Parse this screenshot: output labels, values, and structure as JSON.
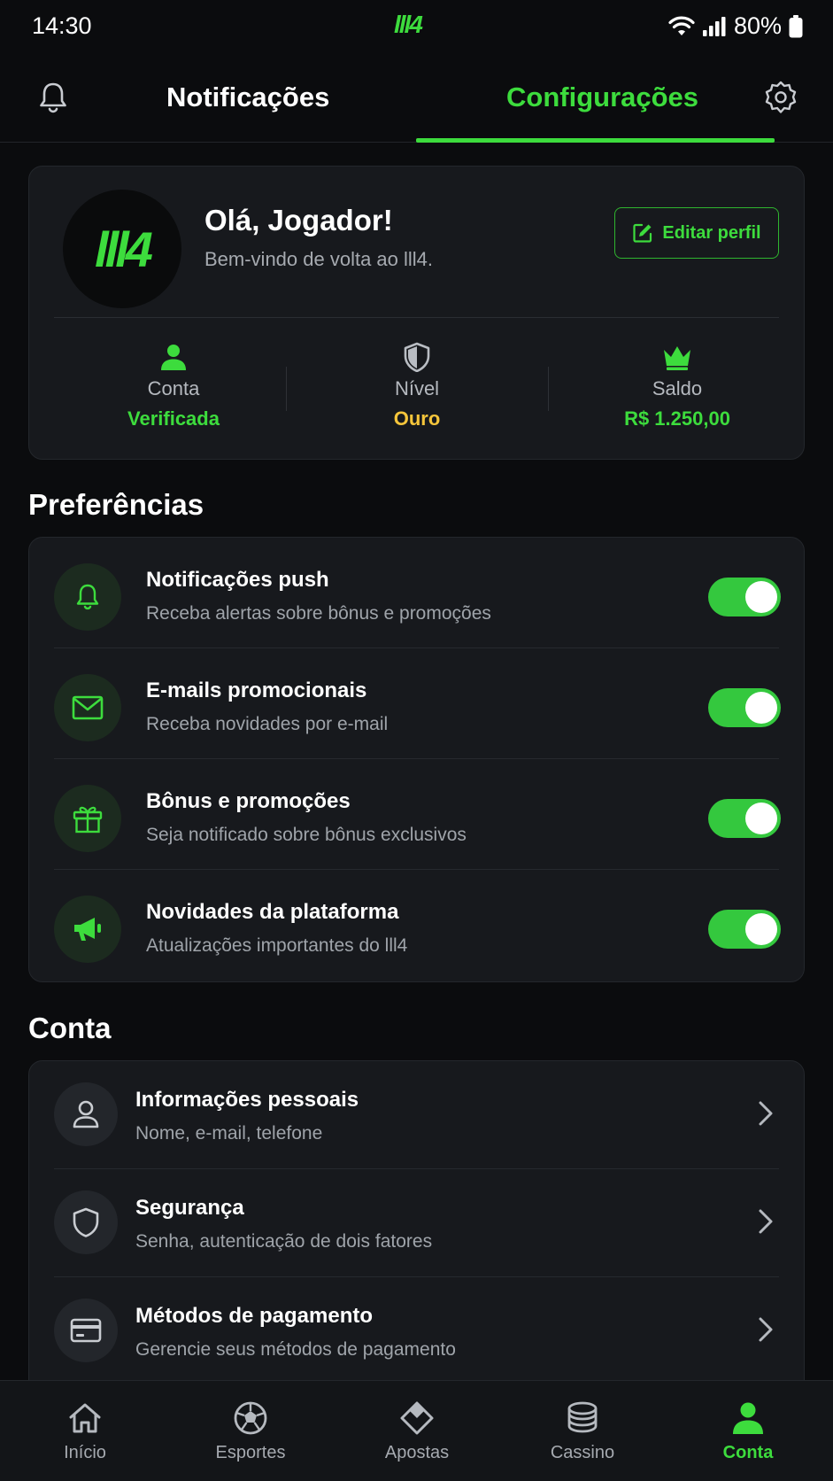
{
  "status_bar": {
    "time": "14:30",
    "logo": "lll4",
    "battery": "80%"
  },
  "top_tabs": {
    "notifications": "Notificações",
    "settings": "Configurações"
  },
  "profile": {
    "avatar_text": "lll4",
    "greeting": "Olá, Jogador!",
    "welcome": "Bem-vindo de volta ao lll4.",
    "edit_button": "Editar perfil",
    "stats": [
      {
        "label": "Conta",
        "value": "Verificada",
        "icon": "user-icon",
        "color": "#3ddc3d"
      },
      {
        "label": "Nível",
        "value": "Ouro",
        "icon": "shield-icon",
        "color": "#f5c53b"
      },
      {
        "label": "Saldo",
        "value": "R$ 1.250,00",
        "icon": "crown-icon",
        "color": "#3ddc3d"
      }
    ]
  },
  "preferences": {
    "title": "Preferências",
    "items": [
      {
        "title": "Notificações push",
        "subtitle": "Receba alertas sobre bônus e promoções",
        "icon": "bell-icon",
        "enabled": true
      },
      {
        "title": "E-mails promocionais",
        "subtitle": "Receba novidades por e-mail",
        "icon": "mail-icon",
        "enabled": true
      },
      {
        "title": "Bônus e promoções",
        "subtitle": "Seja notificado sobre bônus exclusivos",
        "icon": "gift-icon",
        "enabled": true
      },
      {
        "title": "Novidades da plataforma",
        "subtitle": "Atualizações importantes do lll4",
        "icon": "megaphone-icon",
        "enabled": true
      }
    ]
  },
  "account": {
    "title": "Conta",
    "items": [
      {
        "title": "Informações pessoais",
        "subtitle": "Nome, e-mail, telefone",
        "icon": "user-outline-icon"
      },
      {
        "title": "Segurança",
        "subtitle": "Senha, autenticação de dois fatores",
        "icon": "shield-outline-icon"
      },
      {
        "title": "Métodos de pagamento",
        "subtitle": "Gerencie seus métodos de pagamento",
        "icon": "credit-card-icon"
      }
    ]
  },
  "bottom_nav": {
    "items": [
      {
        "label": "Início",
        "icon": "home-icon"
      },
      {
        "label": "Esportes",
        "icon": "soccer-ball-icon"
      },
      {
        "label": "Apostas",
        "icon": "ticket-icon"
      },
      {
        "label": "Cassino",
        "icon": "chips-icon"
      },
      {
        "label": "Conta",
        "icon": "user-icon",
        "active": true
      }
    ]
  },
  "colors": {
    "accent": "#3ddc3d",
    "gold": "#f5c53b",
    "background": "#0b0c0e",
    "card": "#17191d"
  }
}
